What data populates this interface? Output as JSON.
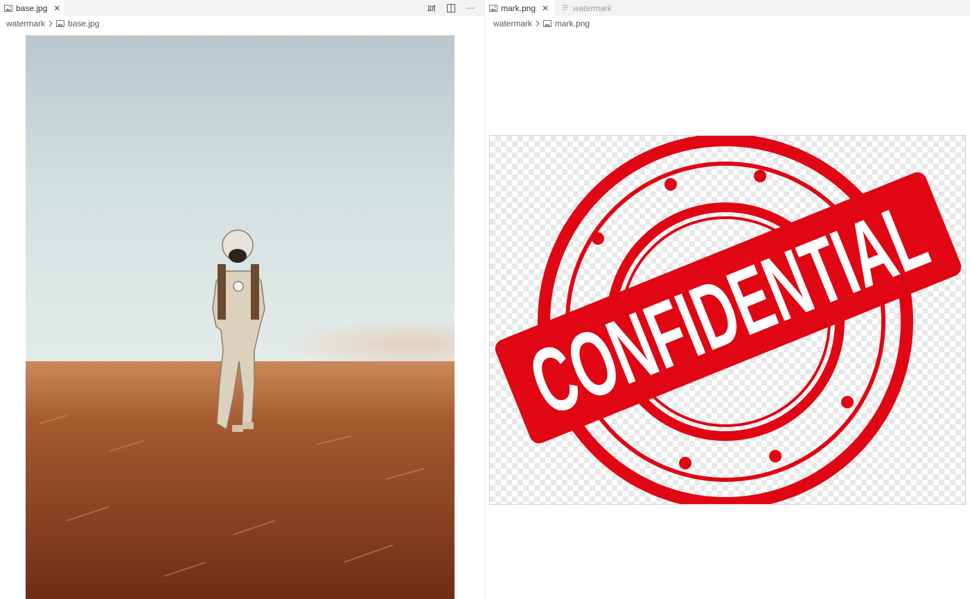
{
  "left_editor": {
    "tab": {
      "label": "base.jpg",
      "close_icon": "close-icon"
    },
    "breadcrumb": {
      "folder": "watermark",
      "file": "base.jpg"
    },
    "actions": [
      "compare-icon",
      "split-editor-icon",
      "more-icon"
    ]
  },
  "right_editor": {
    "tabs": [
      {
        "label": "mark.png",
        "close_icon": "close-icon",
        "active": true
      },
      {
        "label": "watermark",
        "preview": true
      }
    ],
    "breadcrumb": {
      "folder": "watermark",
      "file": "mark.png"
    }
  },
  "stamp": {
    "text": "CONFIDENTIAL",
    "color": "#e10613"
  },
  "colors": {
    "sky": "#c9d8dc",
    "field": "#9a4a24",
    "tabbar": "#f3f3f3"
  }
}
